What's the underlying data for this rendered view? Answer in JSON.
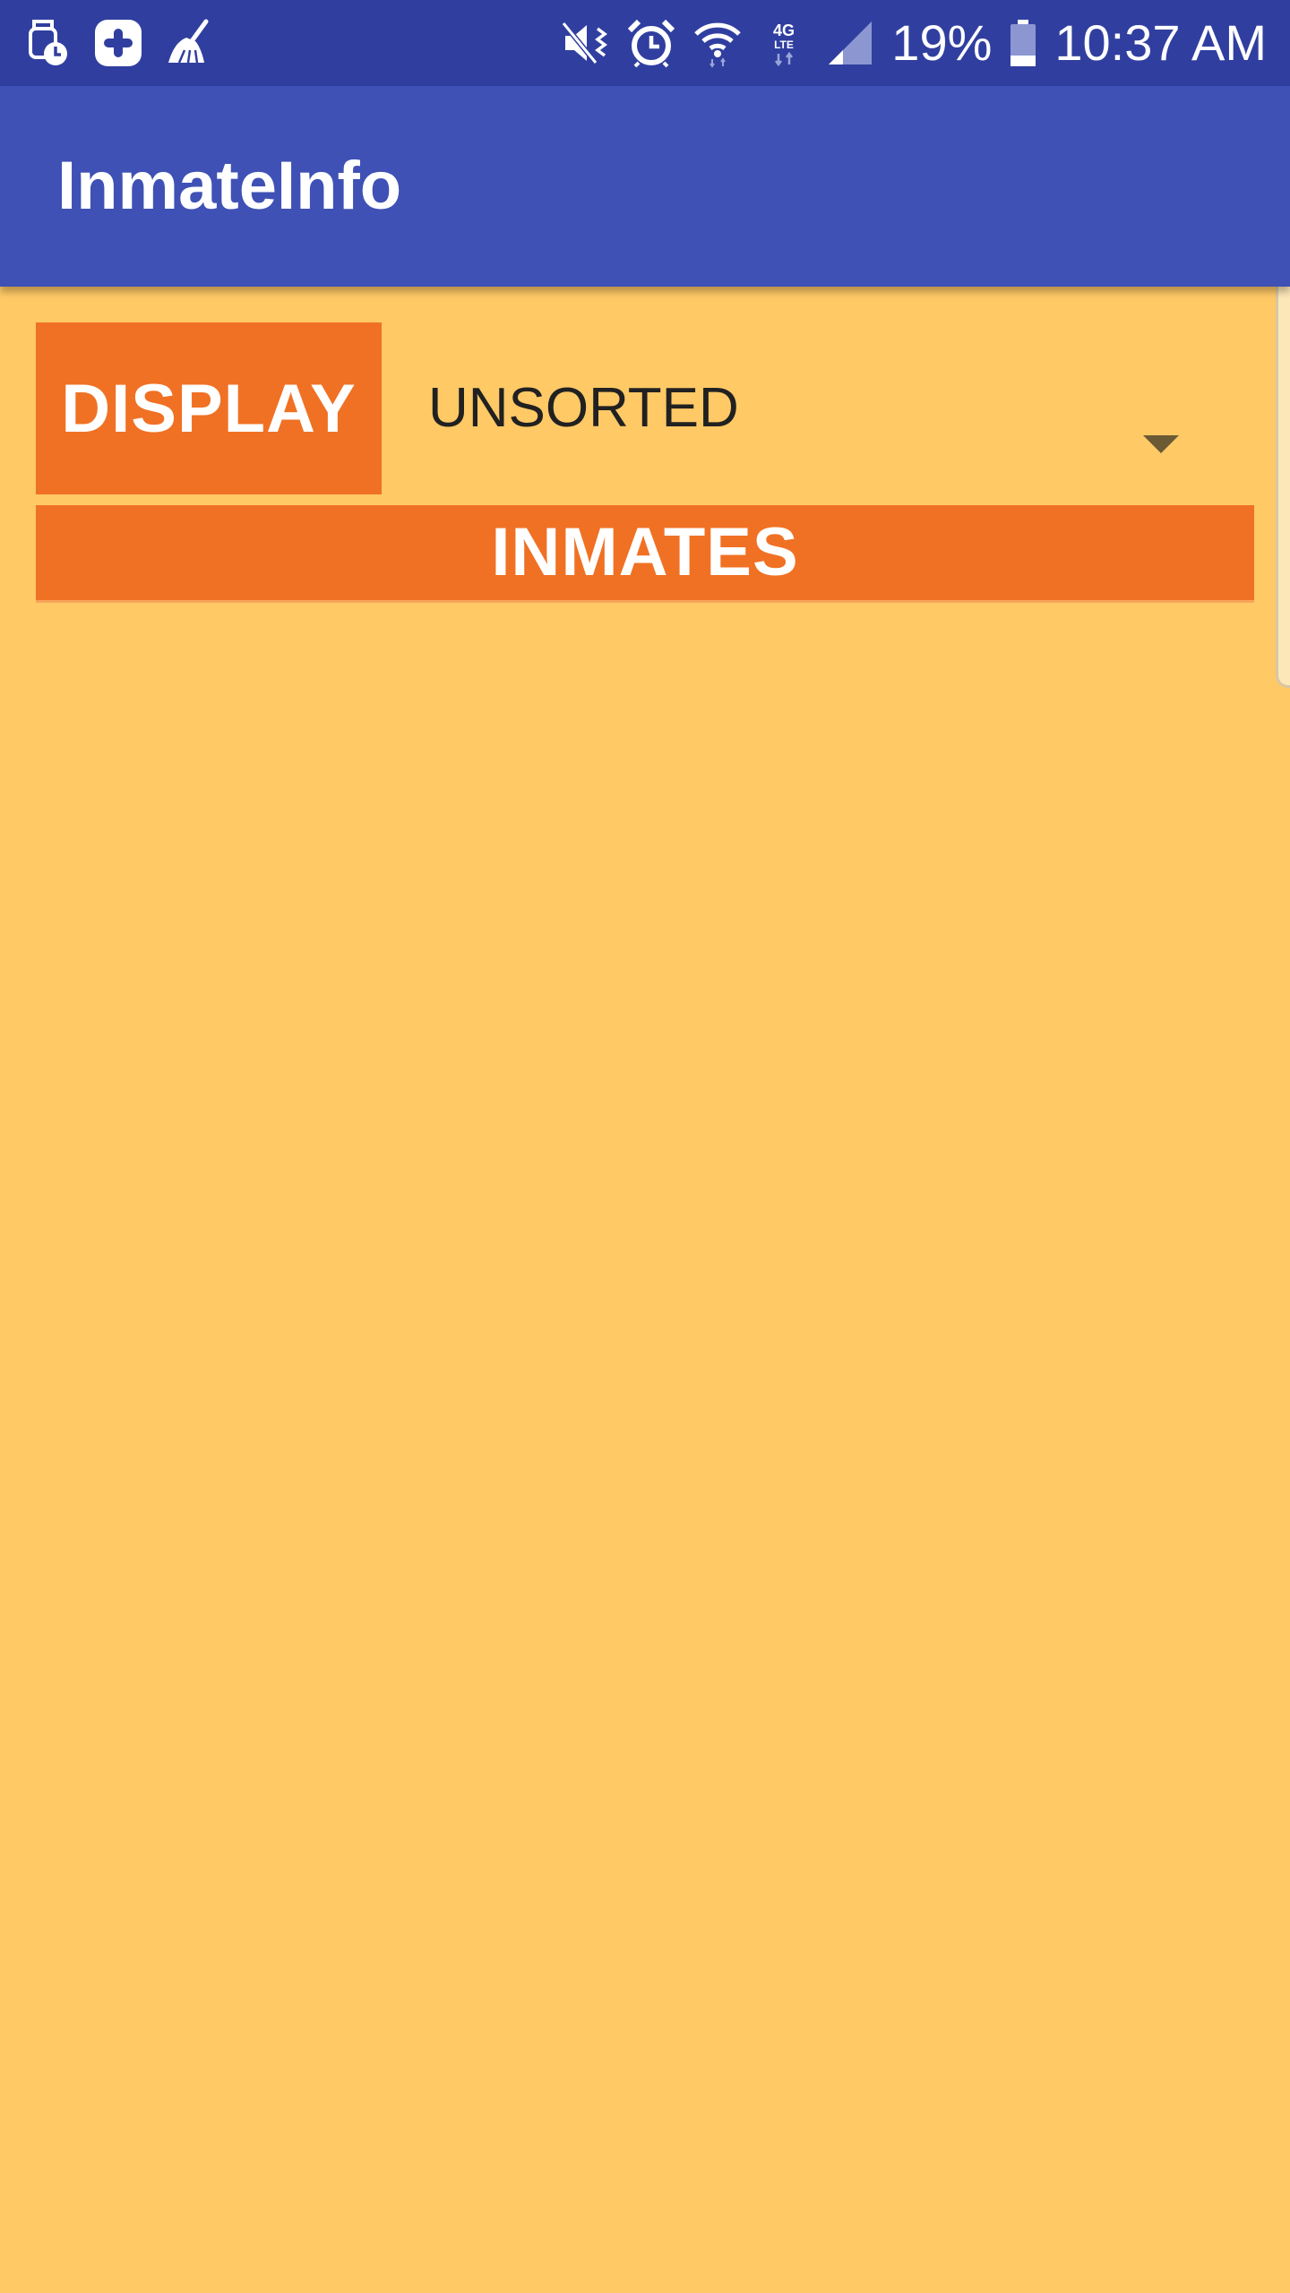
{
  "status_bar": {
    "battery_percent": "19%",
    "time": "10:37 AM",
    "left_icons": [
      "watch-clock-icon",
      "medical-plus-icon",
      "broom-icon"
    ],
    "right_icons": [
      "mute-vibrate-icon",
      "alarm-icon",
      "wifi-icon",
      "4g-lte-icon",
      "signal-icon",
      "battery-icon"
    ]
  },
  "app_bar": {
    "title": "InmateInfo",
    "color": "#3F51B5"
  },
  "controls": {
    "display_label": "DISPLAY",
    "sort_selected": "UNSORTED"
  },
  "list": {
    "header": "INMATES"
  },
  "colors": {
    "status_bar": "#303F9F",
    "accent_orange": "#F07124",
    "background": "#FFC966"
  }
}
